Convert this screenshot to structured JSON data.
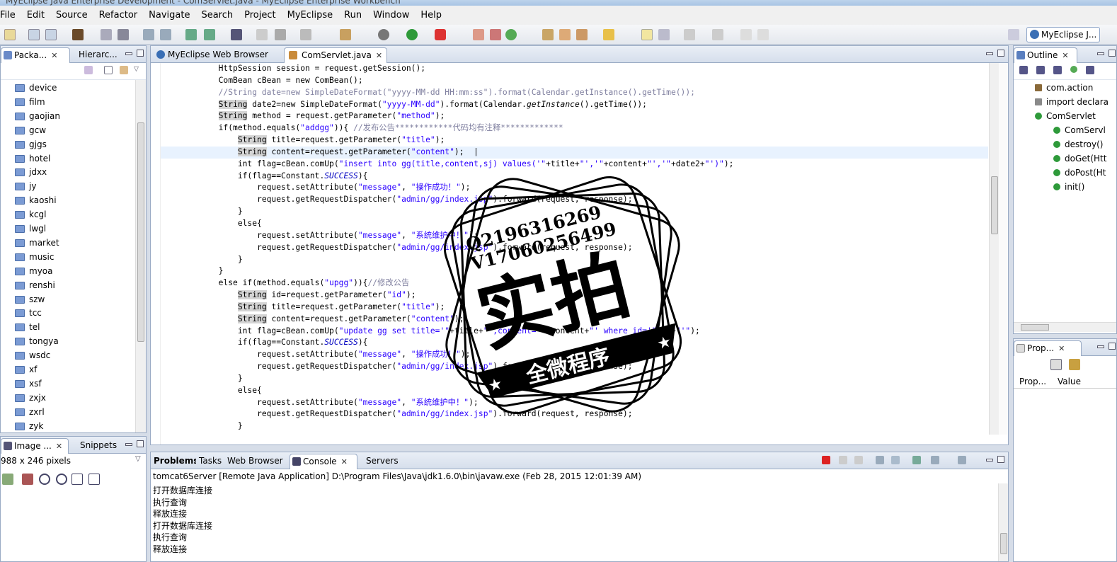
{
  "window": {
    "title": "MyEclipse Java Enterprise Development - ComServlet.java - MyEclipse Enterprise Workbench"
  },
  "menu": [
    "File",
    "Edit",
    "Source",
    "Refactor",
    "Navigate",
    "Search",
    "Project",
    "MyEclipse",
    "Run",
    "Window",
    "Help"
  ],
  "perspective": {
    "label": "MyEclipse J..."
  },
  "left_panel": {
    "tabs": [
      "Packa...",
      "Hierarc..."
    ],
    "items": [
      "device",
      "film",
      "gaojian",
      "gcw",
      "gjgs",
      "hotel",
      "jdxx",
      "jy",
      "kaoshi",
      "kcgl",
      "lwgl",
      "market",
      "music",
      "myoa",
      "renshi",
      "szw",
      "tcc",
      "tel",
      "tongya",
      "wsdc",
      "xf",
      "xsf",
      "zxjx",
      "zxrl",
      "zyk"
    ]
  },
  "image_panel": {
    "tabs": [
      "Image ...",
      "Snippets"
    ],
    "info": "988 x 246 pixels"
  },
  "editor": {
    "tabs": [
      "MyEclipse Web Browser",
      "ComServlet.java"
    ],
    "lines": [
      "            HttpSession session = request.getSession();",
      "            ComBean cBean = new ComBean();",
      "            //String date=new SimpleDateFormat(\"yyyy-MM-dd HH:mm:ss\").format(Calendar.getInstance().getTime());",
      "            String date2=new SimpleDateFormat(\"yyyy-MM-dd\").format(Calendar.getInstance().getTime());",
      "            String method = request.getParameter(\"method\");",
      "            if(method.equals(\"addgg\")){ //发布公告************代码均有注释*************",
      "                String title=request.getParameter(\"title\");",
      "                String content=request.getParameter(\"content\");  |",
      "                int flag=cBean.comUp(\"insert into gg(title,content,sj) values('\"+title+\"','\"+content+\"','\"+date2+\"')\");",
      "                if(flag==Constant.SUCCESS){",
      "                    request.setAttribute(\"message\", \"操作成功！\");",
      "                    request.getRequestDispatcher(\"admin/gg/index.jsp\").forward(request, response);",
      "                }",
      "                else{",
      "                    request.setAttribute(\"message\", \"系统维护中！\");",
      "                    request.getRequestDispatcher(\"admin/gg/index.jsp\").forward(request, response);",
      "                }",
      "            }",
      "            else if(method.equals(\"upgg\")){//修改公告",
      "                String id=request.getParameter(\"id\");",
      "                String title=request.getParameter(\"title\");",
      "                String content=request.getParameter(\"content\");",
      "                int flag=cBean.comUp(\"update gg set title='\"+title+\"',content='\"+content+\"' where id='\"+id+\"'\");",
      "                if(flag==Constant.SUCCESS){",
      "                    request.setAttribute(\"message\", \"操作成功！\");",
      "                    request.getRequestDispatcher(\"admin/gg/index.jsp\").forward(request, response);",
      "                }",
      "                else{",
      "                    request.setAttribute(\"message\", \"系统维护中！\");",
      "                    request.getRequestDispatcher(\"admin/gg/index.jsp\").forward(request, response);",
      "                }"
    ]
  },
  "outline": {
    "tab": "Outline",
    "items": [
      "com.action",
      "import declara",
      "ComServlet",
      "ComServl",
      "destroy()",
      "doGet(Htt",
      "doPost(Ht",
      "init()"
    ]
  },
  "properties": {
    "tab": "Prop...",
    "columns": [
      "Prop...",
      "Value"
    ]
  },
  "console": {
    "tabs": [
      "Problems",
      "Tasks",
      "Web Browser",
      "Console",
      "Servers"
    ],
    "header": "tomcat6Server [Remote Java Application] D:\\Program Files\\Java\\jdk1.6.0\\bin\\javaw.exe (Feb 28, 2015 12:01:39 AM)",
    "lines": [
      "打开数据库连接",
      "执行查询",
      "释放连接",
      "打开数据库连接",
      "执行查询",
      "释放连接"
    ]
  },
  "watermark": {
    "qq": "Q2196316269",
    "vx": "V17060256499",
    "big": "实拍",
    "ribbon": "全微程序"
  },
  "colors": {
    "string": "#2a00ff",
    "comment": "#7f7f9f",
    "constant": "#0000c0",
    "view_border": "#99aac4"
  }
}
